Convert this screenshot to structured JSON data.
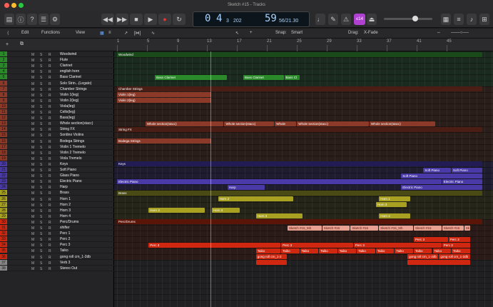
{
  "window": {
    "title": "Sketch #15 - Tracks"
  },
  "lcd": {
    "bar": "4",
    "beat": "3",
    "div": "202",
    "bpm": "59",
    "bpm_sub": "56/21.30",
    "mark": "0"
  },
  "toolbar": {
    "edit": "Edit",
    "functions": "Functions",
    "view": "View",
    "snap_label": "Snap:",
    "snap_val": "Smart",
    "drag_label": "Drag:",
    "drag_val": "X-Fade",
    "badge": "≤14"
  },
  "ruler": {
    "ticks": [
      "1",
      "5",
      "9",
      "13",
      "17",
      "21",
      "25",
      "29",
      "33",
      "37",
      "41",
      "45"
    ]
  },
  "colors": {
    "green": "#2a8a2a",
    "darkred": "#8b2a1a",
    "blue": "#4a3aa8",
    "olive": "#a8a020",
    "red": "#d02810",
    "pink": "#e8a090"
  },
  "tracks": [
    {
      "n": "1",
      "name": "Woodwind",
      "color": "#2a8a2a"
    },
    {
      "n": "2",
      "name": "Flute",
      "color": "#2a8a2a"
    },
    {
      "n": "3",
      "name": "Clarinet",
      "color": "#2a8a2a"
    },
    {
      "n": "4",
      "name": "english horn",
      "color": "#2a8a2a"
    },
    {
      "n": "5",
      "name": "Bass Clarinet",
      "color": "#2a8a2a"
    },
    {
      "n": "6",
      "name": "Solo Strin...(Legato)",
      "color": "#8b3a2a"
    },
    {
      "n": "7",
      "name": "Chamber Strings",
      "color": "#8b3a2a"
    },
    {
      "n": "8",
      "name": "Violin 1(leg)",
      "color": "#8b3a2a"
    },
    {
      "n": "9",
      "name": "Violin 2(leg)",
      "color": "#8b3a2a"
    },
    {
      "n": "10",
      "name": "Viola(leg)",
      "color": "#8b3a2a"
    },
    {
      "n": "11",
      "name": "Cello(leg)",
      "color": "#8b3a2a"
    },
    {
      "n": "12",
      "name": "Bass(leg)",
      "color": "#8b3a2a"
    },
    {
      "n": "13",
      "name": "Whole section(stacc)",
      "color": "#8b3a2a"
    },
    {
      "n": "14",
      "name": "String FX",
      "color": "#8b3a2a"
    },
    {
      "n": "15",
      "name": "Sordino Violins",
      "color": "#8b3a2a"
    },
    {
      "n": "16",
      "name": "Bodega Strings",
      "color": "#8b3a2a"
    },
    {
      "n": "17",
      "name": "Violin 1 Tremelo",
      "color": "#8b3a2a"
    },
    {
      "n": "18",
      "name": "Violin 2 Tremelo",
      "color": "#8b3a2a"
    },
    {
      "n": "19",
      "name": "Viola Tremelo",
      "color": "#8b3a2a"
    },
    {
      "n": "20",
      "name": "Keys",
      "color": "#4a3aa8"
    },
    {
      "n": "21",
      "name": "Soft Piano",
      "color": "#4a3aa8"
    },
    {
      "n": "22",
      "name": "Glass Piano",
      "color": "#4a3aa8"
    },
    {
      "n": "23",
      "name": "Electric Piano",
      "color": "#4a3aa8"
    },
    {
      "n": "24",
      "name": "Harp",
      "color": "#4a3aa8"
    },
    {
      "n": "25",
      "name": "Brass",
      "color": "#a8a020"
    },
    {
      "n": "26",
      "name": "Horn 1",
      "color": "#a8a020"
    },
    {
      "n": "27",
      "name": "Horn 2",
      "color": "#a8a020"
    },
    {
      "n": "28",
      "name": "Horn 3",
      "color": "#a8a020"
    },
    {
      "n": "29",
      "name": "Horn 4",
      "color": "#a8a020"
    },
    {
      "n": "30",
      "name": "Perc/Drums",
      "color": "#d02810"
    },
    {
      "n": "31",
      "name": "shifter",
      "color": "#d02810"
    },
    {
      "n": "32",
      "name": "Perc 1",
      "color": "#d02810"
    },
    {
      "n": "33",
      "name": "Perc 2",
      "color": "#d02810"
    },
    {
      "n": "34",
      "name": "Perc 3",
      "color": "#d02810"
    },
    {
      "n": "35",
      "name": "Taiko",
      "color": "#d02810"
    },
    {
      "n": "36",
      "name": "gong roll crn_1-2db",
      "color": "#d02810"
    },
    {
      "n": "37",
      "name": "Verb 3",
      "color": "#888888"
    },
    {
      "n": "38",
      "name": "Stereo Out",
      "color": "#888888"
    }
  ],
  "regions": [
    {
      "row": 0,
      "s": 0,
      "e": 116,
      "label": "Woodwind",
      "c": "#1a4a1a"
    },
    {
      "row": 4,
      "s": 12,
      "e": 35,
      "label": "Bass Clarinet",
      "c": "#2a8a2a"
    },
    {
      "row": 4,
      "s": 40,
      "e": 53,
      "label": "Bass Clarinet",
      "c": "#2a8a2a"
    },
    {
      "row": 4,
      "s": 53,
      "e": 58,
      "label": "Bass Cl",
      "c": "#2a8a2a"
    },
    {
      "row": 6,
      "s": 0,
      "e": 116,
      "label": "Chamber Strings",
      "c": "#4a1e14"
    },
    {
      "row": 7,
      "s": 0,
      "e": 30,
      "label": "Violin 1(leg)",
      "c": "#8b3a2a"
    },
    {
      "row": 8,
      "s": 0,
      "e": 30,
      "label": "Violin 2(leg)",
      "c": "#8b3a2a"
    },
    {
      "row": 12,
      "s": 9,
      "e": 34,
      "label": "Whole section(stacc)",
      "c": "#8b3a2a"
    },
    {
      "row": 12,
      "s": 34,
      "e": 50,
      "label": "Whole section(stacc)",
      "c": "#8b3a2a"
    },
    {
      "row": 12,
      "s": 50,
      "e": 57,
      "label": "Whole",
      "c": "#8b3a2a"
    },
    {
      "row": 12,
      "s": 57,
      "e": 80,
      "label": "Whole section(stacc)",
      "c": "#8b3a2a"
    },
    {
      "row": 12,
      "s": 80,
      "e": 101,
      "label": "Whole section(stacc)",
      "c": "#8b3a2a"
    },
    {
      "row": 13,
      "s": 0,
      "e": 116,
      "label": "String FX",
      "c": "#4a1e14"
    },
    {
      "row": 15,
      "s": 0,
      "e": 30,
      "label": "Bodega Strings",
      "c": "#8b3a2a"
    },
    {
      "row": 19,
      "s": 0,
      "e": 116,
      "label": "Keys",
      "c": "#221c55"
    },
    {
      "row": 20,
      "s": 97,
      "e": 106,
      "label": "Soft Piano",
      "c": "#4a3aa8"
    },
    {
      "row": 20,
      "s": 106,
      "e": 116,
      "label": "Soft Piano",
      "c": "#4a3aa8"
    },
    {
      "row": 21,
      "s": 90,
      "e": 116,
      "label": "Soft Piano",
      "c": "#4a3aa8"
    },
    {
      "row": 22,
      "s": 0,
      "e": 103,
      "label": "Electric Piano",
      "c": "#4a3aa8"
    },
    {
      "row": 22,
      "s": 103,
      "e": 116,
      "label": "Electric Piano",
      "c": "#4a3aa8"
    },
    {
      "row": 23,
      "s": 35,
      "e": 47,
      "label": "Harp",
      "c": "#4a3aa8"
    },
    {
      "row": 23,
      "s": 90,
      "e": 116,
      "label": "Electric Piano",
      "c": "#4a3aa8"
    },
    {
      "row": 24,
      "s": 0,
      "e": 116,
      "label": "Brass",
      "c": "#4a4a14"
    },
    {
      "row": 25,
      "s": 32,
      "e": 56,
      "label": "Horn 2",
      "c": "#a8a020"
    },
    {
      "row": 25,
      "s": 83,
      "e": 93,
      "label": "Horn 1",
      "c": "#a8a020"
    },
    {
      "row": 26,
      "s": 82,
      "e": 92,
      "label": "Horn 3",
      "c": "#a8a020"
    },
    {
      "row": 27,
      "s": 10,
      "e": 28,
      "label": "Horn 3",
      "c": "#a8a020"
    },
    {
      "row": 27,
      "s": 30,
      "e": 39,
      "label": "Horn 3",
      "c": "#a8a020"
    },
    {
      "row": 28,
      "s": 44,
      "e": 59,
      "label": "Horn 3",
      "c": "#a8a020"
    },
    {
      "row": 28,
      "s": 83,
      "e": 93,
      "label": "Horn 4",
      "c": "#a8a020"
    },
    {
      "row": 29,
      "s": 0,
      "e": 116,
      "label": "Perc/Drums",
      "c": "#5a1408"
    },
    {
      "row": 30,
      "s": 54,
      "e": 65,
      "label": "Sketch #15_5th",
      "c": "#e8a090"
    },
    {
      "row": 30,
      "s": 65,
      "e": 74,
      "label": "Sketch #15",
      "c": "#e8a090"
    },
    {
      "row": 30,
      "s": 74,
      "e": 83,
      "label": "Sketch #15",
      "c": "#e8a090"
    },
    {
      "row": 30,
      "s": 83,
      "e": 94,
      "label": "Sketch #15_5th",
      "c": "#e8a090"
    },
    {
      "row": 30,
      "s": 94,
      "e": 103,
      "label": "Sketch #15",
      "c": "#e8a090"
    },
    {
      "row": 30,
      "s": 103,
      "e": 110,
      "label": "Sketch #15",
      "c": "#e8a090"
    },
    {
      "row": 30,
      "s": 110,
      "e": 112,
      "label": "Sk",
      "c": "#e8a090"
    },
    {
      "row": 32,
      "s": 94,
      "e": 105,
      "label": "Perc 3",
      "c": "#d02810"
    },
    {
      "row": 32,
      "s": 105,
      "e": 112,
      "label": "Perc 3",
      "c": "#d02810"
    },
    {
      "row": 33,
      "s": 10,
      "e": 52,
      "label": "Perc 3",
      "c": "#d02810"
    },
    {
      "row": 33,
      "s": 52,
      "e": 75,
      "label": "Perc 3",
      "c": "#d02810"
    },
    {
      "row": 33,
      "s": 75,
      "e": 103,
      "label": "Perc 3",
      "c": "#d02810"
    },
    {
      "row": 33,
      "s": 103,
      "e": 112,
      "label": "Perc 3",
      "c": "#d02810"
    },
    {
      "row": 34,
      "s": 44,
      "e": 52,
      "label": "Taiko",
      "c": "#d02810"
    },
    {
      "row": 34,
      "s": 52,
      "e": 58,
      "label": "Taiko",
      "c": "#d02810"
    },
    {
      "row": 34,
      "s": 58,
      "e": 64,
      "label": "Taiko",
      "c": "#d02810"
    },
    {
      "row": 34,
      "s": 64,
      "e": 70,
      "label": "Taiko",
      "c": "#d02810"
    },
    {
      "row": 34,
      "s": 70,
      "e": 76,
      "label": "Taiko",
      "c": "#d02810"
    },
    {
      "row": 34,
      "s": 76,
      "e": 82,
      "label": "Taiko",
      "c": "#d02810"
    },
    {
      "row": 34,
      "s": 82,
      "e": 88,
      "label": "Taiko",
      "c": "#d02810"
    },
    {
      "row": 34,
      "s": 88,
      "e": 94,
      "label": "Taiko",
      "c": "#d02810"
    },
    {
      "row": 34,
      "s": 94,
      "e": 100,
      "label": "Taiko",
      "c": "#d02810"
    },
    {
      "row": 34,
      "s": 100,
      "e": 106,
      "label": "Taiko",
      "c": "#d02810"
    },
    {
      "row": 34,
      "s": 106,
      "e": 112,
      "label": "Taiko",
      "c": "#d02810"
    },
    {
      "row": 35,
      "s": 44,
      "e": 54,
      "label": "gong roll crn_1-2",
      "c": "#d02810"
    },
    {
      "row": 35,
      "s": 92,
      "e": 102,
      "label": "gong roll crn_1-2db",
      "c": "#d02810"
    },
    {
      "row": 35,
      "s": 102,
      "e": 112,
      "label": "gong roll crn_1-2db",
      "c": "#d02810"
    },
    {
      "row": 36,
      "s": 44,
      "e": 54,
      "label": "",
      "c": "#d02810"
    },
    {
      "row": 36,
      "s": 92,
      "e": 112,
      "label": "",
      "c": "#d02810"
    }
  ]
}
